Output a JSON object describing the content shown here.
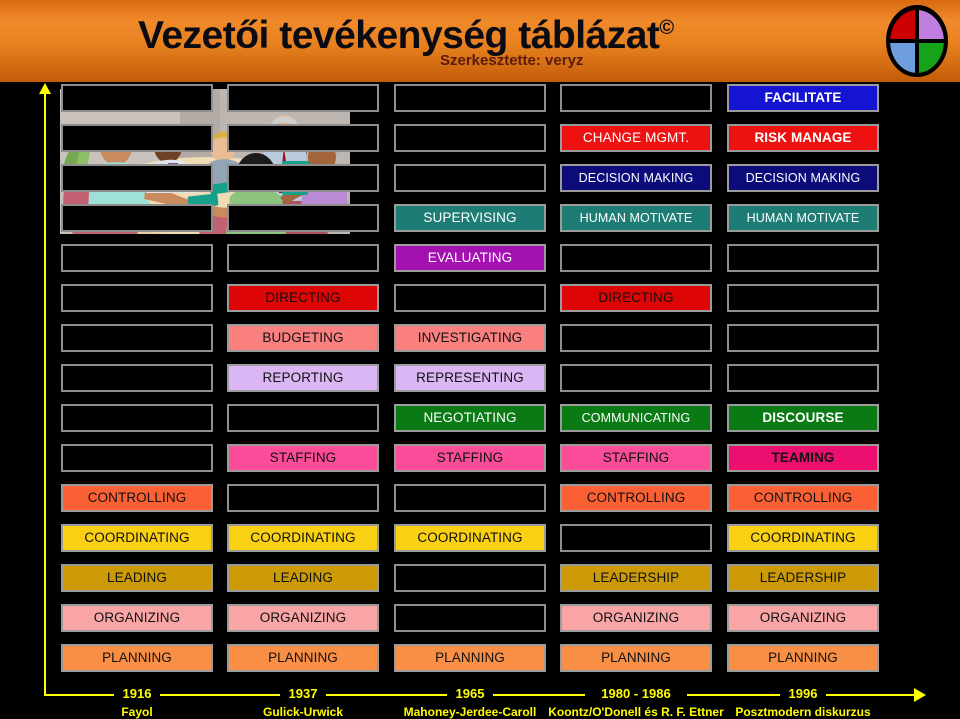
{
  "header": {
    "title": "Vezetői tevékenység táblázat",
    "copyright_mark": "©",
    "subtitle": "Szerkesztette: veryz",
    "logo_name": "quadrant-circle-logo",
    "bg_color": "#e8801f",
    "title_color": "#0b0b14",
    "subtitle_color": "#5a1b08"
  },
  "photo": {
    "alt": "business meeting clipart"
  },
  "axes": {
    "color": "#ffff00",
    "vertical_name": "vertical-arrow-axis",
    "horizontal_name": "horizontal-time-axis"
  },
  "palette": {
    "facilitate": "#1414d2",
    "risk": "#ee1111",
    "change": "#ee1111",
    "decision": "#0b0b7a",
    "human": "#1d7d74",
    "supervising": "#1d7d74",
    "evaluating": "#a311b0",
    "directing": "#dd0505",
    "budgeting": "#fa8080",
    "investigating": "#fa8080",
    "reporting": "#dbb6f5",
    "representing": "#dbb6f5",
    "negotiating": "#0a7a14",
    "communicating": "#0a7a14",
    "discourse": "#0a7a14",
    "staffing": "#fb4c9a",
    "teaming": "#ec0f70",
    "controlling": "#fb6035",
    "coordinating": "#fad012",
    "leading": "#cc9a06",
    "organizing": "#f9a5a5",
    "planning": "#f98f45",
    "empty": "#000000",
    "border": "#9b9b9b"
  },
  "table": {
    "columns": [
      "1916 Fayol",
      "1937 Gulick-Urwick",
      "1965 Mahoney-Jerdee-Caroll",
      "1980 - 1986 Koontz/O'Donell és R. F. Ettner",
      "1996 Posztmodern diskurzus"
    ],
    "rows": [
      {
        "name": "row-facilitate",
        "cells": [
          {
            "label": "",
            "color": "empty",
            "style": "empty"
          },
          {
            "label": "",
            "color": "empty",
            "style": "empty"
          },
          {
            "label": "",
            "color": "empty",
            "style": "empty"
          },
          {
            "label": "",
            "color": "empty",
            "style": "empty"
          },
          {
            "label": "FACILITATE",
            "color": "facilitate",
            "style": "light bold"
          }
        ]
      },
      {
        "name": "row-change-mgmt",
        "cells": [
          {
            "label": "",
            "color": "empty",
            "style": "empty"
          },
          {
            "label": "",
            "color": "empty",
            "style": "empty"
          },
          {
            "label": "",
            "color": "empty",
            "style": "empty"
          },
          {
            "label": "CHANGE  MGMT.",
            "color": "change",
            "style": "light"
          },
          {
            "label": "RISK MANAGE",
            "color": "risk",
            "style": "light bold"
          }
        ]
      },
      {
        "name": "row-decision-making",
        "cells": [
          {
            "label": "",
            "color": "empty",
            "style": "empty"
          },
          {
            "label": "",
            "color": "empty",
            "style": "empty"
          },
          {
            "label": "",
            "color": "empty",
            "style": "empty"
          },
          {
            "label": "DECISION MAKING",
            "color": "decision",
            "style": "light sm"
          },
          {
            "label": "DECISION MAKING",
            "color": "decision",
            "style": "light sm"
          }
        ]
      },
      {
        "name": "row-human-motivate",
        "cells": [
          {
            "label": "",
            "color": "empty",
            "style": "empty"
          },
          {
            "label": "",
            "color": "empty",
            "style": "empty"
          },
          {
            "label": "SUPERVISING",
            "color": "supervising",
            "style": "light"
          },
          {
            "label": "HUMAN MOTIVATE",
            "color": "human",
            "style": "light sm"
          },
          {
            "label": "HUMAN MOTIVATE",
            "color": "human",
            "style": "light sm"
          }
        ]
      },
      {
        "name": "row-evaluating",
        "cells": [
          {
            "label": "",
            "color": "empty",
            "style": "empty"
          },
          {
            "label": "",
            "color": "empty",
            "style": "empty"
          },
          {
            "label": "EVALUATING",
            "color": "evaluating",
            "style": "light"
          },
          {
            "label": "",
            "color": "empty",
            "style": "empty"
          },
          {
            "label": "",
            "color": "empty",
            "style": "empty"
          }
        ]
      },
      {
        "name": "row-directing",
        "cells": [
          {
            "label": "",
            "color": "empty",
            "style": "empty"
          },
          {
            "label": "DIRECTING",
            "color": "directing",
            "style": ""
          },
          {
            "label": "",
            "color": "empty",
            "style": "empty"
          },
          {
            "label": "DIRECTING",
            "color": "directing",
            "style": ""
          },
          {
            "label": "",
            "color": "empty",
            "style": "empty"
          }
        ]
      },
      {
        "name": "row-budgeting",
        "cells": [
          {
            "label": "",
            "color": "empty",
            "style": "empty"
          },
          {
            "label": "BUDGETING",
            "color": "budgeting",
            "style": ""
          },
          {
            "label": "INVESTIGATING",
            "color": "investigating",
            "style": ""
          },
          {
            "label": "",
            "color": "empty",
            "style": "empty"
          },
          {
            "label": "",
            "color": "empty",
            "style": "empty"
          }
        ]
      },
      {
        "name": "row-reporting",
        "cells": [
          {
            "label": "",
            "color": "empty",
            "style": "empty"
          },
          {
            "label": "REPORTING",
            "color": "reporting",
            "style": ""
          },
          {
            "label": "REPRESENTING",
            "color": "representing",
            "style": ""
          },
          {
            "label": "",
            "color": "empty",
            "style": "empty"
          },
          {
            "label": "",
            "color": "empty",
            "style": "empty"
          }
        ]
      },
      {
        "name": "row-negotiating",
        "cells": [
          {
            "label": "",
            "color": "empty",
            "style": "empty"
          },
          {
            "label": "",
            "color": "empty",
            "style": "empty"
          },
          {
            "label": "NEGOTIATING",
            "color": "negotiating",
            "style": "light"
          },
          {
            "label": "COMMUNICATING",
            "color": "communicating",
            "style": "light sm"
          },
          {
            "label": "DISCOURSE",
            "color": "discourse",
            "style": "light bold"
          }
        ]
      },
      {
        "name": "row-staffing",
        "cells": [
          {
            "label": "",
            "color": "empty",
            "style": "empty"
          },
          {
            "label": "STAFFING",
            "color": "staffing",
            "style": ""
          },
          {
            "label": "STAFFING",
            "color": "staffing",
            "style": ""
          },
          {
            "label": "STAFFING",
            "color": "staffing",
            "style": ""
          },
          {
            "label": "TEAMING",
            "color": "teaming",
            "style": "bold"
          }
        ]
      },
      {
        "name": "row-controlling",
        "cells": [
          {
            "label": "CONTROLLING",
            "color": "controlling",
            "style": ""
          },
          {
            "label": "",
            "color": "empty",
            "style": "empty"
          },
          {
            "label": "",
            "color": "empty",
            "style": "empty"
          },
          {
            "label": "CONTROLLING",
            "color": "controlling",
            "style": ""
          },
          {
            "label": "CONTROLLING",
            "color": "controlling",
            "style": ""
          }
        ]
      },
      {
        "name": "row-coordinating",
        "cells": [
          {
            "label": "COORDINATING",
            "color": "coordinating",
            "style": ""
          },
          {
            "label": "COORDINATING",
            "color": "coordinating",
            "style": ""
          },
          {
            "label": "COORDINATING",
            "color": "coordinating",
            "style": ""
          },
          {
            "label": "",
            "color": "empty",
            "style": "empty"
          },
          {
            "label": "COORDINATING",
            "color": "coordinating",
            "style": ""
          }
        ]
      },
      {
        "name": "row-leading",
        "cells": [
          {
            "label": "LEADING",
            "color": "leading",
            "style": ""
          },
          {
            "label": "LEADING",
            "color": "leading",
            "style": ""
          },
          {
            "label": "",
            "color": "empty",
            "style": "empty"
          },
          {
            "label": "LEADERSHIP",
            "color": "leading",
            "style": ""
          },
          {
            "label": "LEADERSHIP",
            "color": "leading",
            "style": ""
          }
        ]
      },
      {
        "name": "row-organizing",
        "cells": [
          {
            "label": "ORGANIZING",
            "color": "organizing",
            "style": ""
          },
          {
            "label": "ORGANIZING",
            "color": "organizing",
            "style": ""
          },
          {
            "label": "",
            "color": "empty",
            "style": "empty"
          },
          {
            "label": "ORGANIZING",
            "color": "organizing",
            "style": ""
          },
          {
            "label": "ORGANIZING",
            "color": "organizing",
            "style": ""
          }
        ]
      },
      {
        "name": "row-planning",
        "cells": [
          {
            "label": "PLANNING",
            "color": "planning",
            "style": ""
          },
          {
            "label": "PLANNING",
            "color": "planning",
            "style": ""
          },
          {
            "label": "PLANNING",
            "color": "planning",
            "style": ""
          },
          {
            "label": "PLANNING",
            "color": "planning",
            "style": ""
          },
          {
            "label": "PLANNING",
            "color": "planning",
            "style": ""
          }
        ]
      }
    ]
  },
  "timeline": {
    "entries": [
      {
        "year": "1916",
        "author": "Fayol"
      },
      {
        "year": "1937",
        "author": "Gulick-Urwick"
      },
      {
        "year": "1965",
        "author": "Mahoney-Jerdee-Caroll"
      },
      {
        "year": "1980 - 1986",
        "author": "Koontz/O'Donell és R. F. Ettner"
      },
      {
        "year": "1996",
        "author": "Posztmodern diskurzus"
      }
    ]
  }
}
